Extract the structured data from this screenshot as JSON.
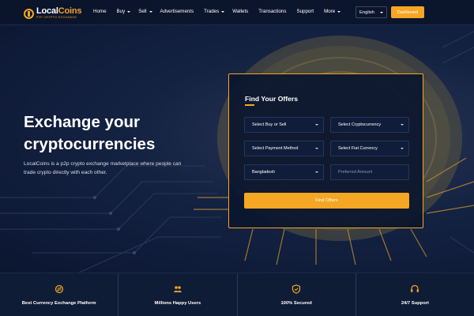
{
  "brand": {
    "name_part1": "Local",
    "name_part2": "Coins",
    "tagline": "P2P CRYPTO EXCHANGE"
  },
  "nav": {
    "items": [
      {
        "label": "Home",
        "dropdown": false
      },
      {
        "label": "Buy",
        "dropdown": true
      },
      {
        "label": "Sell",
        "dropdown": true
      },
      {
        "label": "Advertisements",
        "dropdown": false
      },
      {
        "label": "Trades",
        "dropdown": true
      },
      {
        "label": "Wallets",
        "dropdown": false
      },
      {
        "label": "Transactions",
        "dropdown": false
      },
      {
        "label": "Support",
        "dropdown": false
      },
      {
        "label": "More",
        "dropdown": true
      }
    ],
    "language": "English",
    "dashboard_label": "Dashboard"
  },
  "hero": {
    "title_line1": "Exchange your",
    "title_line2": "cryptocurrencies",
    "description": "LocalCoins is a p2p crypto exchange marketplace where people can trade crypto directly with each other."
  },
  "offers": {
    "title": "Find Your Offers",
    "buy_or_sell": "Select Buy or Sell",
    "cryptocurrency": "Select Cryptocurrency",
    "payment_method": "Select Payment Method",
    "fiat_currency": "Select Fiat Currency",
    "country": "Bangladesh",
    "amount_placeholder": "Preferred Amount",
    "submit_label": "Find Offers"
  },
  "features": [
    {
      "label": "Best Currency Exchange Platform",
      "icon": "exchange-icon"
    },
    {
      "label": "Millions Happy Users",
      "icon": "users-icon"
    },
    {
      "label": "100% Secured",
      "icon": "shield-icon"
    },
    {
      "label": "24/7 Support",
      "icon": "headset-icon"
    }
  ],
  "colors": {
    "accent": "#f5a623",
    "background": "#0d1a33",
    "panel": "#0b162e"
  }
}
